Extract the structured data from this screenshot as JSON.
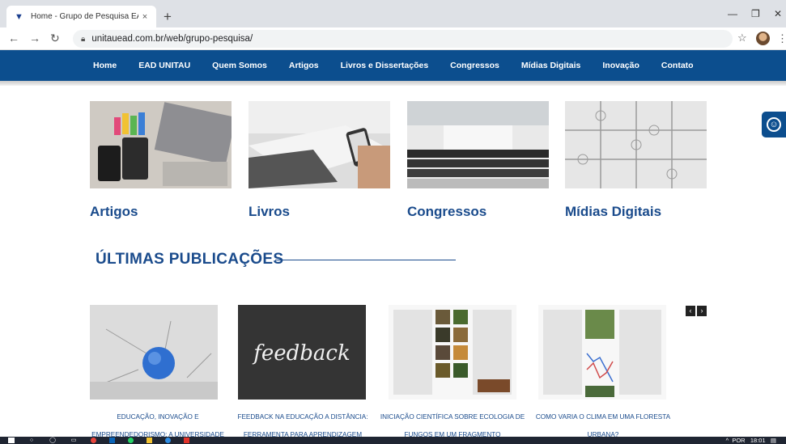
{
  "browser": {
    "tab_title": "Home - Grupo de Pesquisa EAD ·",
    "tab_close": "×",
    "new_tab": "+",
    "url": "unitauead.com.br/web/grupo-pesquisa/",
    "icons": [
      "back-icon",
      "forward-icon",
      "reload-icon",
      "lock-icon",
      "star-icon",
      "avatar",
      "menu-icon"
    ]
  },
  "nav": {
    "items": [
      "Home",
      "EAD UNITAU",
      "Quem Somos",
      "Artigos",
      "Livros e Dissertações",
      "Congressos",
      "Mídias Digitais",
      "Inovação",
      "Contato"
    ]
  },
  "categories": [
    "Artigos",
    "Livros",
    "Congressos",
    "Mídias Digitais"
  ],
  "section": {
    "title": "ÚLTIMAS PUBLICAÇÕES"
  },
  "publications": [
    {
      "caption": "EDUCAÇÃO, INOVAÇÃO E EMPREENDEDORISMO: A UNIVERSIDADE"
    },
    {
      "caption": "FEEDBACK NA EDUCAÇÃO A DISTÂNCIA: FERRAMENTA PARA APRENDIZAGEM",
      "image_text": "feedback"
    },
    {
      "caption": "INICIAÇÃO CIENTÍFICA SOBRE ECOLOGIA DE FUNGOS EM UM FRAGMENTO"
    },
    {
      "caption": "COMO VARIA O CLIMA EM UMA FLORESTA URBANA?"
    }
  ],
  "carousel": {
    "prev": "‹",
    "next": "›"
  },
  "taskbar": {
    "lang": "POR",
    "time": "18:01"
  }
}
